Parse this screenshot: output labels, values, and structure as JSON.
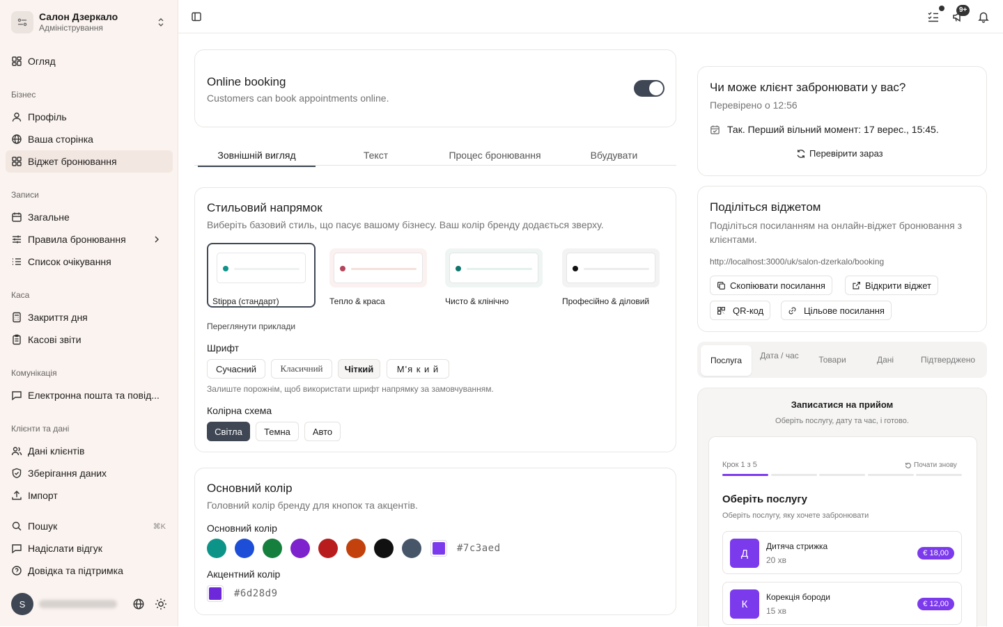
{
  "org": {
    "name": "Салон Дзеркало",
    "subtitle": "Адміністрування"
  },
  "nav": {
    "overview": "Огляд",
    "business_group": "Бізнес",
    "profile": "Профіль",
    "your_page": "Ваша сторінка",
    "booking_widget": "Віджет бронювання",
    "records_group": "Записи",
    "general": "Загальне",
    "booking_rules": "Правила бронювання",
    "waitlist": "Список очікування",
    "cash_group": "Каса",
    "day_close": "Закриття дня",
    "cash_reports": "Касові звіти",
    "comm_group": "Комунікація",
    "email": "Електронна пошта та повід...",
    "clients_group": "Клієнти та дані",
    "client_data": "Дані клієнтів",
    "data_storage": "Зберігання даних",
    "import": "Імпорт",
    "search": "Пошук",
    "search_kbd": "⌘K",
    "feedback": "Надіслати відгук",
    "help": "Довідка та підтримка"
  },
  "user": {
    "initial": "S"
  },
  "topbar": {
    "badge": "9+"
  },
  "online_booking": {
    "title": "Online booking",
    "description": "Customers can book appointments online.",
    "enabled": true
  },
  "tabs": [
    "Зовнішній вигляд",
    "Текст",
    "Процес бронювання",
    "Вбудувати"
  ],
  "style": {
    "title": "Стильовий напрямок",
    "description": "Виберіть базовий стиль, що пасує вашому бізнесу. Ваш колір бренду додається зверху.",
    "options": [
      {
        "name": "Stippa (стандарт)",
        "dot": "#0d9488",
        "line": "#eef1f1",
        "bg": "#ffffff"
      },
      {
        "name": "Тепло & краса",
        "dot": "#b4455a",
        "line": "#f6dede",
        "bg": "#faf1f0"
      },
      {
        "name": "Чисто & клінічно",
        "dot": "#0f766e",
        "line": "#e2f0ee",
        "bg": "#eef5f3"
      },
      {
        "name": "Професійно & діловий",
        "dot": "#111111",
        "line": "#ececec",
        "bg": "#f3f3f3"
      }
    ],
    "examples_link": "Переглянути приклади",
    "font_label": "Шрифт",
    "fonts": [
      "Сучасний",
      "Класичний",
      "Чіткий",
      "М'я к и й"
    ],
    "font_hint": "Залиште порожнім, щоб використати шрифт напрямку за замовчуванням.",
    "scheme_label": "Колірна схема",
    "schemes": [
      "Світла",
      "Темна",
      "Авто"
    ]
  },
  "colors": {
    "title": "Основний колір",
    "description": "Головний колір бренду для кнопок та акцентів.",
    "primary_label": "Основний колір",
    "swatches": [
      "#0d9488",
      "#1d4ed8",
      "#15803d",
      "#7e22ce",
      "#b91c1c",
      "#c2410c",
      "#111111",
      "#475569"
    ],
    "primary_value": "#7c3aed",
    "accent_label": "Акцентний колір",
    "accent_value": "#6d28d9"
  },
  "check": {
    "title": "Чи може клієнт забронювати у вас?",
    "checked_at": "Перевірено о 12:56",
    "result": "Так. Перший вільний момент: 17 верес., 15:45.",
    "button": "Перевірити зараз"
  },
  "share": {
    "title": "Поділіться віджетом",
    "description": "Поділіться посиланням на онлайн-віджет бронювання з клієнтами.",
    "url": "http://localhost:3000/uk/salon-dzerkalo/booking",
    "copy": "Скопіювати посилання",
    "open": "Відкрити віджет",
    "qr": "QR-код",
    "target": "Цільове посилання"
  },
  "preview_tabs": [
    "Послуга",
    "Дата / час",
    "Товари",
    "Дані",
    "Підтверджено"
  ],
  "preview": {
    "title": "Записатися на прийом",
    "subtitle": "Оберіть послугу, дату та час, і готово.",
    "step": "Крок 1 з 5",
    "restart": "Почати знову",
    "heading": "Оберіть послугу",
    "hint": "Оберіть послугу, яку хочете забронювати",
    "services": [
      {
        "initial": "Д",
        "name": "Дитяча стрижка",
        "duration": "20 хв",
        "price": "€ 18,00"
      },
      {
        "initial": "К",
        "name": "Корекція бороди",
        "duration": "15 хв",
        "price": "€ 12,00"
      }
    ]
  }
}
